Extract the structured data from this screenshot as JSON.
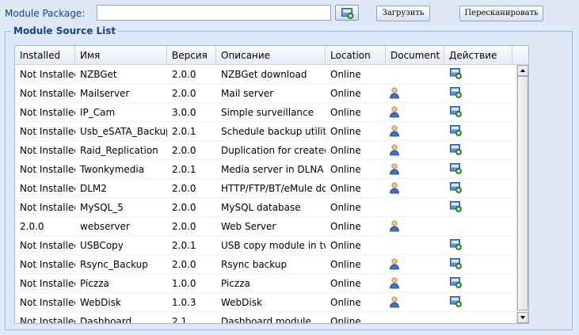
{
  "toolbar": {
    "package_label": "Module Package:",
    "package_value": "",
    "load_label": "Загрузить",
    "rescan_label": "Пересканировать"
  },
  "legend": "Module Source List",
  "columns": [
    "Installed",
    "Имя",
    "Версия",
    "Описание",
    "Location",
    "Document",
    "Действие"
  ],
  "rows": [
    {
      "installed": "Not Installed",
      "name": "NZBGet",
      "version": "2.0.0",
      "desc": "NZBGet download",
      "location": "Online",
      "doc": false,
      "action": true
    },
    {
      "installed": "Not Installed",
      "name": "Mailserver",
      "version": "2.0.0",
      "desc": "Mail server",
      "location": "Online",
      "doc": true,
      "action": true
    },
    {
      "installed": "Not Installed",
      "name": "IP_Cam",
      "version": "3.0.0",
      "desc": "Simple surveillance",
      "location": "Online",
      "doc": true,
      "action": true
    },
    {
      "installed": "Not Installed",
      "name": "Usb_eSATA_Backup",
      "version": "2.0.1",
      "desc": "Schedule backup utility f",
      "location": "Online",
      "doc": true,
      "action": true
    },
    {
      "installed": "Not Installed",
      "name": "Raid_Replication",
      "version": "2.0.0",
      "desc": "Duplication for created R",
      "location": "Online",
      "doc": true,
      "action": true
    },
    {
      "installed": "Not Installed",
      "name": "Twonkymedia",
      "version": "2.0.1",
      "desc": "Media server in DLNA",
      "location": "Online",
      "doc": true,
      "action": true
    },
    {
      "installed": "Not Installed",
      "name": "DLM2",
      "version": "2.0.0",
      "desc": "HTTP/FTP/BT/eMule do",
      "location": "Online",
      "doc": true,
      "action": true
    },
    {
      "installed": "Not Installed",
      "name": "MySQL_5",
      "version": "2.0.0",
      "desc": "MySQL database",
      "location": "Online",
      "doc": false,
      "action": true
    },
    {
      "installed": "2.0.0",
      "name": "webserver",
      "version": "2.0.0",
      "desc": "Web Server",
      "location": "Online",
      "doc": true,
      "action": false
    },
    {
      "installed": "Not Installed",
      "name": "USBCopy",
      "version": "2.0.1",
      "desc": "USB copy module in two",
      "location": "Online",
      "doc": false,
      "action": true
    },
    {
      "installed": "Not Installed",
      "name": "Rsync_Backup",
      "version": "2.0.0",
      "desc": "Rsync backup",
      "location": "Online",
      "doc": true,
      "action": true
    },
    {
      "installed": "Not Installed",
      "name": "Piczza",
      "version": "1.0.0",
      "desc": "Piczza",
      "location": "Online",
      "doc": true,
      "action": true
    },
    {
      "installed": "Not Installed",
      "name": "WebDisk",
      "version": "1.0.3",
      "desc": "WebDisk",
      "location": "Online",
      "doc": true,
      "action": true
    },
    {
      "installed": "Not Installed",
      "name": "Dashboard",
      "version": "2.1",
      "desc": "Dashboard module",
      "location": "Online",
      "doc": false,
      "action": false
    }
  ],
  "icons": {
    "doc": "user-document-icon",
    "action": "install-module-icon",
    "browse": "browse-file-icon"
  }
}
